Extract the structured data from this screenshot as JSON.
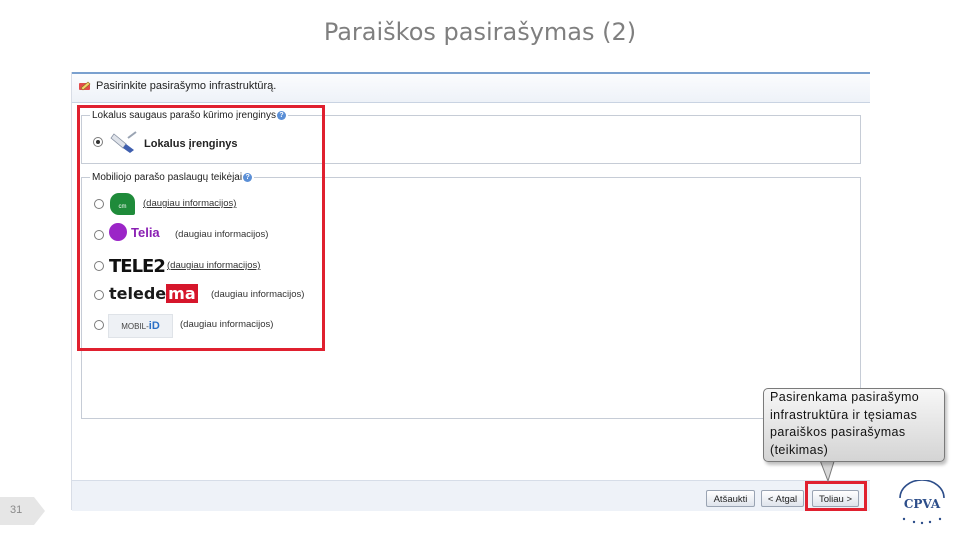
{
  "slide": {
    "title": "Paraiškos pasirašymas (2)",
    "number": "31"
  },
  "window": {
    "header_title": "Pasirinkite pasirašymo infrastruktūrą."
  },
  "local_group": {
    "legend": "Lokalus saugaus parašo kūrimo įrenginys",
    "option_label": "Lokalus įrenginys",
    "selected": true
  },
  "mobile_group": {
    "legend": "Mobiliojo parašo paslaugų teikėjai",
    "providers": [
      {
        "logo_icon": "cm-logo",
        "logo_text": "cm",
        "link": "(daugiau informacijos)",
        "selected": false
      },
      {
        "logo_icon": "telia-logo",
        "logo_text": "Telia",
        "link": "(daugiau informacijos)",
        "selected": false
      },
      {
        "logo_icon": "tele2-logo",
        "logo_text": "TELE2",
        "link": "(daugiau informacijos)",
        "selected": false
      },
      {
        "logo_icon": "teledema-logo",
        "logo_text_a": "telede",
        "logo_text_b": "ma",
        "link": "(daugiau informacijos)",
        "selected": false
      },
      {
        "logo_icon": "mobil-id-logo",
        "logo_text_a": "MOBIL-",
        "logo_text_b": "iD",
        "link": "(daugiau informacijos)",
        "selected": false
      }
    ]
  },
  "buttons": {
    "cancel": "Atšaukti",
    "back": "< Atgal",
    "next": "Toliau >"
  },
  "callout": {
    "text": "Pasirenkama pasirašymo infrastruktūra ir tęsiamas paraiškos pasirašymas (teikimas)"
  },
  "logo": {
    "text": "CPVA"
  },
  "colors": {
    "highlight": "#e0202f",
    "title_gray": "#7f7f7f",
    "header_accent": "#7aa0cf"
  }
}
